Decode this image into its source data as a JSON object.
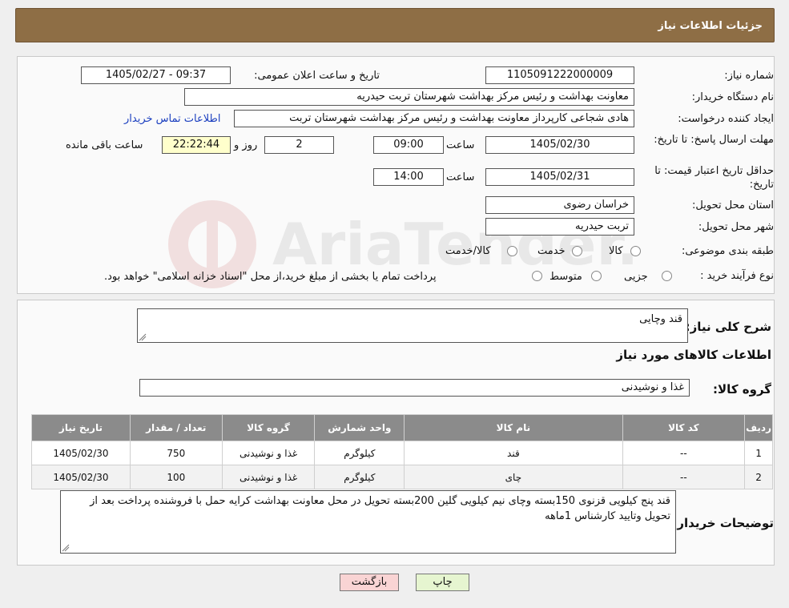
{
  "header": {
    "title": "جزئیات اطلاعات نیاز"
  },
  "form": {
    "need_number_label": "شماره نیاز:",
    "need_number": "1105091222000009",
    "announce_label": "تاریخ و ساعت اعلان عمومی:",
    "announce_value": "1405/02/27 - 09:37",
    "buyer_org_label": "نام دستگاه خریدار:",
    "buyer_org": "معاونت بهداشت و رئیس مرکز بهداشت شهرستان تربت حیدریه",
    "creator_label": "ایجاد کننده درخواست:",
    "creator": "هادی شجاعی کارپرداز معاونت بهداشت و رئیس مرکز بهداشت شهرستان تربت",
    "contact_link": "اطلاعات تماس خریدار",
    "reply_deadline_label": "مهلت ارسال پاسخ: تا تاریخ:",
    "reply_date": "1405/02/30",
    "time_label": "ساعت",
    "reply_time": "09:00",
    "days_value": "2",
    "days_label": "روز و",
    "remaining_time": "22:22:44",
    "remaining_label": "ساعت باقی مانده",
    "price_validity_label": "حداقل تاریخ اعتبار قیمت: تا تاریخ:",
    "price_date": "1405/02/31",
    "price_time": "14:00",
    "province_label": "استان محل تحویل:",
    "province": "خراسان رضوی",
    "city_label": "شهر محل تحویل:",
    "city": "تربت حیدریه",
    "category_label": "طبقه بندی موضوعی:",
    "category_options": [
      "کالا",
      "خدمت",
      "کالا/خدمت"
    ],
    "process_label": "نوع فرآیند خرید :",
    "process_options": [
      "جزیی",
      "متوسط"
    ],
    "process_note": "پرداخت تمام یا بخشی از مبلغ خرید،از محل \"اسناد خزانه اسلامی\" خواهد بود."
  },
  "description": {
    "label": "شرح کلی نیاز:",
    "value": "قند وچایی"
  },
  "goods": {
    "section_title": "اطلاعات کالاهای مورد نیاز",
    "group_label": "گروه کالا:",
    "group_value": "غذا و نوشیدنی"
  },
  "table": {
    "headers": [
      "ردیف",
      "کد کالا",
      "نام کالا",
      "واحد شمارش",
      "گروه کالا",
      "تعداد / مقدار",
      "تاریخ نیاز"
    ],
    "rows": [
      [
        "1",
        "--",
        "قند",
        "کیلوگرم",
        "غذا و نوشیدنی",
        "750",
        "1405/02/30"
      ],
      [
        "2",
        "--",
        "چای",
        "کیلوگرم",
        "غذا و نوشیدنی",
        "100",
        "1405/02/30"
      ]
    ]
  },
  "buyer_notes": {
    "label": "توضیحات خریدار:",
    "value": "قند پنج کیلویی قزنوی 150بسته وچای نیم کیلویی گلین 200بسته تحویل در محل معاونت بهداشت کرایه حمل با فروشنده پرداخت بعد از تحویل وتایید کارشناس 1ماهه"
  },
  "buttons": {
    "print": "چاپ",
    "back": "بازگشت"
  },
  "watermark": {
    "text": "AriaTender.net"
  },
  "colors": {
    "header_bg": "#8e6e45",
    "table_header_bg": "#8b8b8b",
    "back_button_bg": "#f9d4d4",
    "print_button_bg": "#e6f5d0",
    "link": "#1a3ebf"
  }
}
